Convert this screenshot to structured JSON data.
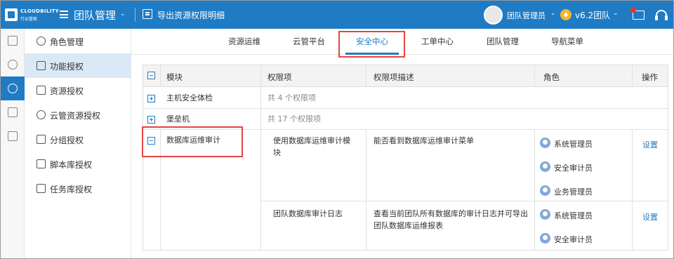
{
  "header": {
    "logo_line1": "CLOUDBILITY",
    "logo_line2": "行云管家",
    "team_title": "团队管理",
    "export_label": "导出资源权限明细",
    "user_name": "团队管理员",
    "version_label": "v6.2团队",
    "brand_color": "#1f7bc4",
    "notification_color": "#e8342f"
  },
  "rail": {
    "icons": [
      "document-icon",
      "users-icon",
      "team-icon",
      "devices-icon",
      "book-icon"
    ],
    "active_index": 2
  },
  "subnav": {
    "items": [
      {
        "label": "角色管理",
        "icon": "person-icon"
      },
      {
        "label": "功能授权",
        "icon": "list-icon"
      },
      {
        "label": "资源授权",
        "icon": "monitor-icon"
      },
      {
        "label": "云管资源授权",
        "icon": "cloud-icon"
      },
      {
        "label": "分组授权",
        "icon": "folder-icon"
      },
      {
        "label": "脚本库授权",
        "icon": "script-icon"
      },
      {
        "label": "任务库授权",
        "icon": "task-icon"
      }
    ],
    "active_index": 1
  },
  "tabs": {
    "items": [
      "资源运维",
      "云管平台",
      "安全中心",
      "工单中心",
      "团队管理",
      "导航菜单"
    ],
    "active_index": 2
  },
  "table": {
    "headers": [
      "模块",
      "权限项",
      "权限项描述",
      "角色",
      "操作"
    ],
    "rows": [
      {
        "module": "主机安全体检",
        "summary": "共 4 个权限项",
        "expanded": false
      },
      {
        "module": "堡垒机",
        "summary": "共 17 个权限项",
        "expanded": false
      },
      {
        "module": "数据库运维审计",
        "expanded": true,
        "items": [
          {
            "permission": "使用数据库运维审计模块",
            "description": "能否看到数据库运维审计菜单",
            "roles": [
              "系统管理员",
              "安全审计员",
              "业务管理员"
            ],
            "action": "设置"
          },
          {
            "permission": "团队数据库审计日志",
            "description": "查看当前团队所有数据库的审计日志并可导出团队数据库运维报表",
            "roles": [
              "系统管理员",
              "安全审计员"
            ],
            "action": "设置"
          }
        ]
      }
    ]
  }
}
